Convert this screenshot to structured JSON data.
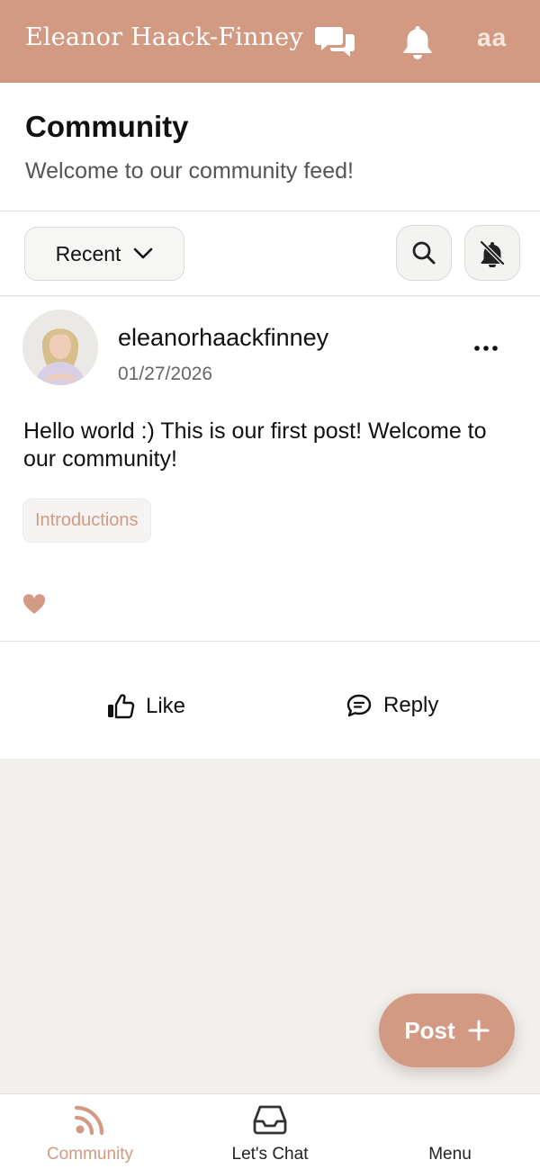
{
  "topbar": {
    "brand": "Eleanor Haack-Finney",
    "avatar_initials": "aa",
    "icons": [
      "chat-bubbles-icon",
      "bell-icon"
    ]
  },
  "header": {
    "title": "Community",
    "subtitle": "Welcome to our community feed!"
  },
  "filter": {
    "sort_label": "Recent",
    "icons": [
      "search-icon",
      "bell-off-icon"
    ]
  },
  "post": {
    "author": "eleanorhaackfinney",
    "date": "01/27/2026",
    "body": "Hello world :) This is our first post! Welcome to our community!",
    "tag": "Introductions",
    "like_label": "Like",
    "reply_label": "Reply"
  },
  "fab": {
    "label": "Post"
  },
  "tabs": [
    {
      "label": "Community",
      "icon": "rss-icon",
      "active": true
    },
    {
      "label": "Let's Chat",
      "icon": "inbox-icon",
      "active": false
    },
    {
      "label": "Menu",
      "icon": "",
      "active": false
    }
  ],
  "colors": {
    "brand": "#d29a83",
    "feed_background": "#f1f0ed"
  }
}
